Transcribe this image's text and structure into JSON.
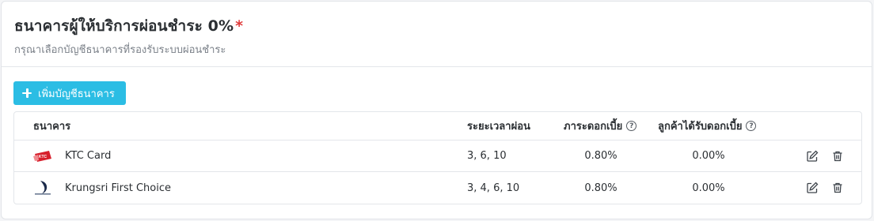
{
  "header": {
    "title": "ธนาคารผู้ให้บริการผ่อนชำระ 0%",
    "required_mark": "*",
    "subtitle": "กรุณาเลือกบัญชีธนาคารที่รองรับระบบผ่อนชำระ"
  },
  "add_button": {
    "label": "เพิ่มบัญชีธนาคาร",
    "icon": "plus-icon"
  },
  "table": {
    "columns": {
      "bank": "ธนาคาร",
      "period": "ระยะเวลาผ่อน",
      "rate": "ภาระดอกเบี้ย",
      "customer": "ลูกค้าได้รับดอกเบี้ย"
    },
    "rows": [
      {
        "bank": "KTC Card",
        "logo_text": "KTC",
        "period": "3, 6, 10",
        "rate": "0.80%",
        "customer": "0.00%"
      },
      {
        "bank": "Krungsri First Choice",
        "period": "3, 4, 6, 10",
        "rate": "0.80%",
        "customer": "0.00%"
      }
    ]
  },
  "colors": {
    "accent": "#2bbde4",
    "required": "#e03b3b",
    "ktc_red": "#d71f2c",
    "krungsri_navy": "#1b2a4a"
  }
}
